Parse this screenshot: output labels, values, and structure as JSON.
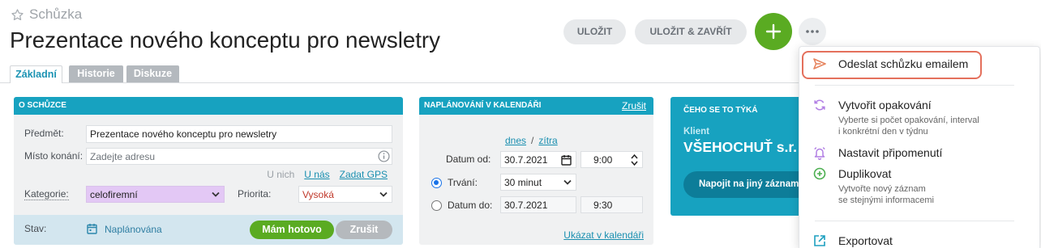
{
  "colors": {
    "accent": "#17a2c0",
    "green": "#5aab22",
    "highlight": "#e4705c",
    "category_bg": "#e3c8f5",
    "priority_text": "#c0392b"
  },
  "icons": {
    "favorite": "star-icon",
    "add": "plus-icon",
    "more": "more-horizontal-icon",
    "location_info": "info-icon",
    "dropdown": "chevron-down-icon",
    "status": "calendar-icon",
    "date_picker": "calendar-icon",
    "time_stepper": "spinner-icon",
    "send_email": "send-icon",
    "repeat": "repeat-icon",
    "reminder": "bell-icon",
    "duplicate": "plus-circle-icon",
    "export": "export-icon"
  },
  "header": {
    "record_type": "Schůzka",
    "title": "Prezentace nového konceptu pro newsletry",
    "save_label": "ULOŽIT",
    "save_close_label": "ULOŽIT & ZAVŘÍT"
  },
  "tabs": [
    {
      "label": "Základní",
      "active": true
    },
    {
      "label": "Historie",
      "active": false
    },
    {
      "label": "Diskuze",
      "active": false
    }
  ],
  "about": {
    "heading": "O SCHŮZCE",
    "subject_label": "Předmět:",
    "subject_value": "Prezentace nového konceptu pro newsletry",
    "location_label": "Místo konání:",
    "location_placeholder": "Zadejte adresu",
    "location_links": {
      "at_them": "U nich",
      "at_us": "U nás",
      "gps": "Zadat GPS"
    },
    "category_label": "Kategorie:",
    "category_value": "celofiremní",
    "priority_label": "Priorita:",
    "priority_value": "Vysoká",
    "status_label": "Stav:",
    "status_value": "Naplánována",
    "done_label": "Mám hotovo",
    "cancel_label": "Zrušit"
  },
  "schedule": {
    "heading": "NAPLÁNOVÁNÍ V KALENDÁŘI",
    "cancel_link": "Zrušit",
    "today_link": "dnes",
    "separator": "/",
    "tomorrow_link": "zítra",
    "from_label": "Datum od:",
    "from_date": "30.7.2021",
    "from_time": "9:00",
    "duration_label": "Trvání:",
    "duration_value": "30 minut",
    "duration_selected": true,
    "to_label": "Datum do:",
    "to_date": "30.7.2021",
    "to_time": "9:30",
    "to_selected": false,
    "show_link": "Ukázat v kalendáři"
  },
  "related": {
    "heading": "ČEHO SE TO TÝKÁ",
    "client_label": "Klient",
    "client_name": "VŠEHOCHUŤ s.r.",
    "relink_label": "Napojit na jiný záznam"
  },
  "menu": {
    "items": [
      {
        "label": "Odeslat schůzku emailem",
        "highlighted": true
      },
      {
        "label": "Vytvořit opakování",
        "description": [
          "Vyberte si počet opakování, interval",
          "i konkrétní den v týdnu"
        ]
      },
      {
        "label": "Nastavit připomenutí"
      },
      {
        "label": "Duplikovat",
        "description": [
          "Vytvořte nový záznam",
          "se stejnými informacemi"
        ]
      },
      {
        "label": "Exportovat"
      }
    ]
  }
}
